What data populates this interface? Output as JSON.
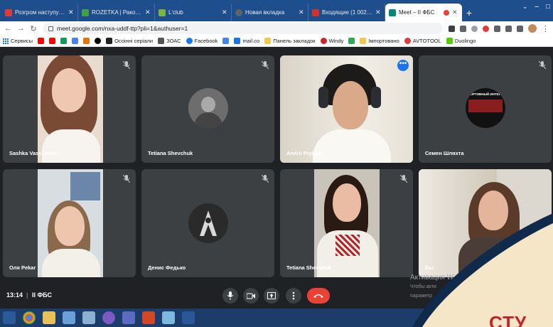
{
  "browser": {
    "tabs": [
      {
        "title": "Розгром наступу РФ н",
        "favicon_color": "#e53935"
      },
      {
        "title": "ROZETKA | Раковина",
        "favicon_color": "#43a047"
      },
      {
        "title": "L'club",
        "favicon_color": "#7cb342"
      },
      {
        "title": "Новая вкладка",
        "favicon_color": "#5f6368"
      },
      {
        "title": "Входящие (1 002) - m",
        "favicon_color": "#d93025"
      },
      {
        "title": "Meet – II ФБС",
        "favicon_color": "#00897b"
      }
    ],
    "new_tab_symbol": "+",
    "url": "meet.google.com/nxa-uddf-ttp?pli=1&authuser=1",
    "bookmarks": [
      {
        "label": "Сервисы",
        "color": "#1a73e8"
      },
      {
        "label": "",
        "color": "#ff0000"
      },
      {
        "label": "",
        "color": "#ff0000"
      },
      {
        "label": "",
        "color": "#0f9d58"
      },
      {
        "label": "",
        "color": "#4285f4"
      },
      {
        "label": "",
        "color": "#e8710a"
      },
      {
        "label": "",
        "color": "#000000"
      },
      {
        "label": "Осоінні серіали",
        "color": "#222222"
      },
      {
        "label": "ЗОАС",
        "color": "#555555"
      },
      {
        "label": "Facebook",
        "color": "#1877f2"
      },
      {
        "label": "",
        "color": "#4285f4"
      },
      {
        "label": "mail.co",
        "color": "#1a73e8"
      },
      {
        "label": "Панель закладок",
        "color": "#f2c94c"
      },
      {
        "label": "Windy",
        "color": "#c62828"
      },
      {
        "label": "",
        "color": "#34a853"
      },
      {
        "label": "Імпортовано",
        "color": "#f2c94c"
      },
      {
        "label": "AVTOTOOL",
        "color": "#e53935"
      },
      {
        "label": "Duolingo",
        "color": "#58cc02"
      }
    ]
  },
  "meet": {
    "participants": [
      {
        "name": "Sashka Vasylynets"
      },
      {
        "name": "Tetiana Shevchuk"
      },
      {
        "name": "Andrii Prykop"
      },
      {
        "name": "Семен Шляхта"
      },
      {
        "name": "Оля Pekar"
      },
      {
        "name": "Денис Федько"
      },
      {
        "name": "Tetiana Shevchuk"
      },
      {
        "name": "Вы"
      }
    ],
    "sport_logo_text": "СПОРТИВНЫЙ ИНТЕРЕС",
    "more_options_symbol": "•••",
    "time": "13:14",
    "separator": "|",
    "meeting_name": "II ФБС",
    "activation": {
      "title": "Активация W",
      "line1": "Чтобы акти",
      "line2": "параметр"
    }
  },
  "overlay": {
    "text": "СТУ",
    "text_color": "#c8202a"
  }
}
